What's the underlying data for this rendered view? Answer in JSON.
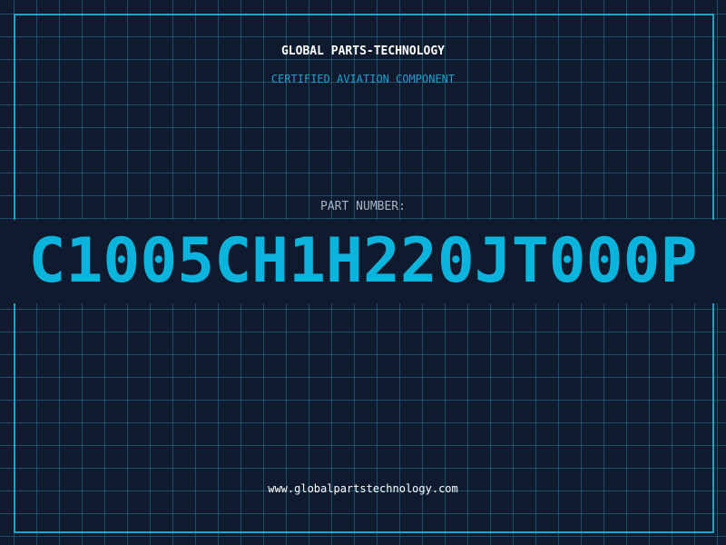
{
  "brand": {
    "name": "GLOBAL PARTS-TECHNOLOGY",
    "tagline": "CERTIFIED AVIATION COMPONENT"
  },
  "part": {
    "label": "PART NUMBER:",
    "number": "C1005CH1H220JT000P"
  },
  "footer": {
    "url": "www.globalpartstechnology.com"
  },
  "colors": {
    "background": "#0f1a2e",
    "grid": "#1f607a",
    "frame": "#1fa3c9",
    "accent": "#0ab4dc",
    "label": "#a9b4c2",
    "text": "#ffffff"
  }
}
